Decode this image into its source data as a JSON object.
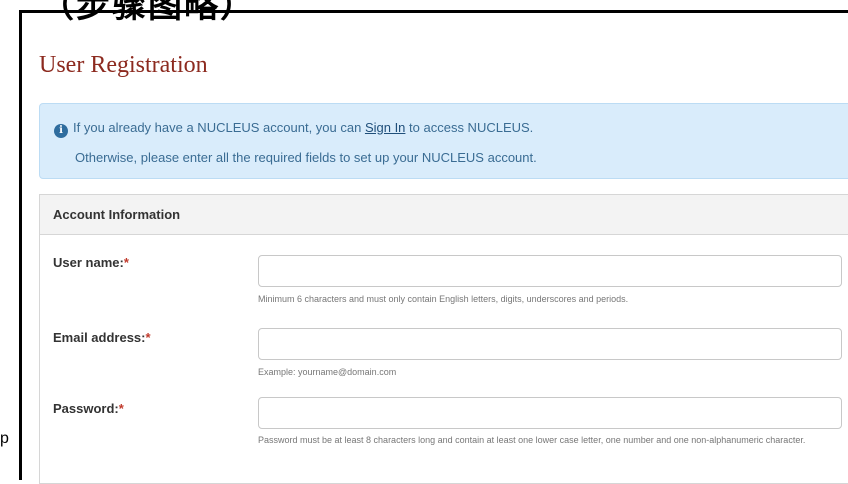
{
  "top_text": "（步骤图略）",
  "stray_char": "p",
  "page": {
    "title": "User Registration"
  },
  "info": {
    "icon": "info-circle-icon",
    "prefix": "If you already have a NUCLEUS account, you can ",
    "sign_in_link": "Sign In",
    "suffix": " to access NUCLEUS.",
    "line2": "Otherwise, please enter all the required fields to set up your NUCLEUS account."
  },
  "account": {
    "heading": "Account Information",
    "fields": [
      {
        "label": "User name:",
        "required_mark": "*",
        "value": "",
        "help": "Minimum 6 characters and must only contain English letters, digits, underscores and periods."
      },
      {
        "label": "Email address:",
        "required_mark": "*",
        "value": "",
        "help": "Example: yourname@domain.com"
      },
      {
        "label": "Password:",
        "required_mark": "*",
        "value": "",
        "help": "Password must be at least 8 characters long and contain at least one lower case letter, one number and one non-alphanumeric character."
      }
    ]
  },
  "colors": {
    "title": "#8c2a1f",
    "info_bg": "#d9ecfb",
    "info_text": "#3a6c93",
    "required": "#c0392b"
  }
}
